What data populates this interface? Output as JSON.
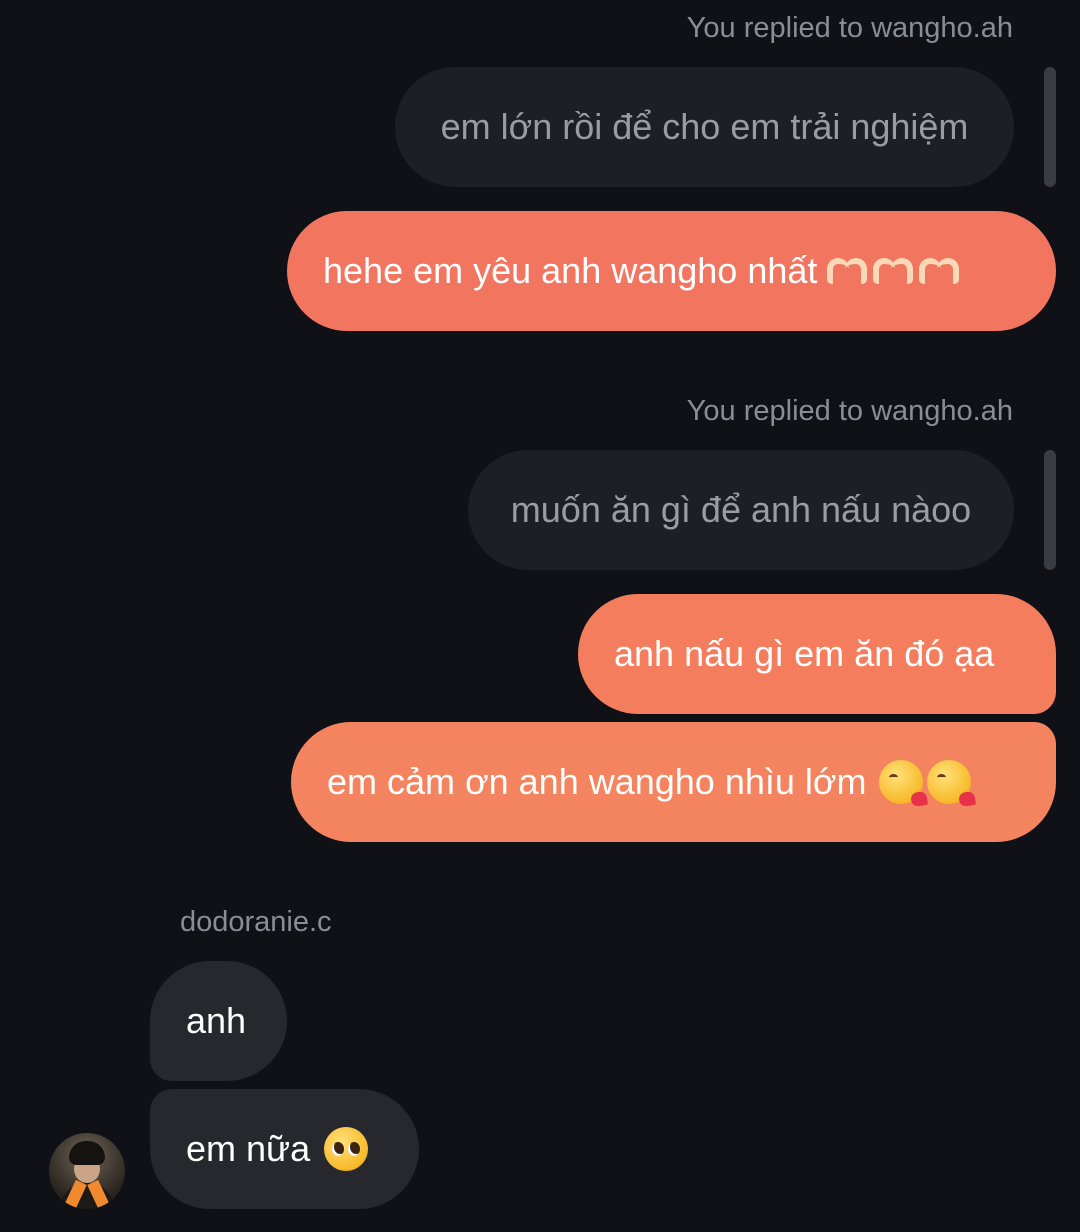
{
  "conversation": {
    "reply_group_1": {
      "reply_label": "You replied to wangho.ah",
      "quoted_message": "em lớn rồi để cho em trải nghiệm",
      "reply_message": "hehe em yêu anh wangho nhất",
      "reply_emoji": "heart-hands-emoji x3"
    },
    "reply_group_2": {
      "reply_label": "You replied to wangho.ah",
      "quoted_message": "muốn ăn gì để anh nấu nàoo",
      "reply_message": "anh nấu gì em ăn đó ạa"
    },
    "sent_message_3": {
      "text": "em cảm ơn anh wangho nhìu lớm",
      "emoji": "kissing-heart-emoji x2"
    },
    "received_group": {
      "sender_name": "dodoranie.c",
      "messages": [
        {
          "text": "anh"
        },
        {
          "text": "em nữa",
          "emoji": "pleading-face-emoji"
        }
      ],
      "avatar": "user-avatar"
    }
  },
  "colors": {
    "background": "#0f1117",
    "quoted_bubble": "#1e1f24",
    "received_bubble": "#26282e",
    "sent_bubble_1": "#f27560",
    "sent_bubble_2": "#f47d5e",
    "sent_bubble_3": "#f4845f",
    "meta_text": "#8a8d96"
  }
}
